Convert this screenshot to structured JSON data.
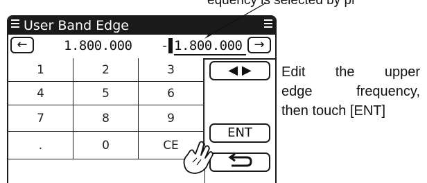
{
  "caption_top": "equency is  selected by  pr",
  "screen": {
    "title": "User Band Edge",
    "freq_lower": "1.800.000",
    "freq_separator": "-",
    "freq_upper": "1.800.000",
    "left_arrow": "←",
    "right_arrow": "→"
  },
  "keypad": {
    "keys": [
      "1",
      "2",
      "3",
      "4",
      "5",
      "6",
      "7",
      "8",
      "9",
      ".",
      "0",
      "CE"
    ],
    "side": {
      "cursor_label": "◀ ▶",
      "ent_label": "ENT",
      "back_label": "⮌"
    }
  },
  "instruction": {
    "line1": "Edit the upper",
    "line2": "edge frequency,",
    "line3": "then touch [ENT]"
  },
  "icons": {
    "menu": "menu-icon",
    "hand": "hand-pointer-icon",
    "back": "return-icon"
  }
}
